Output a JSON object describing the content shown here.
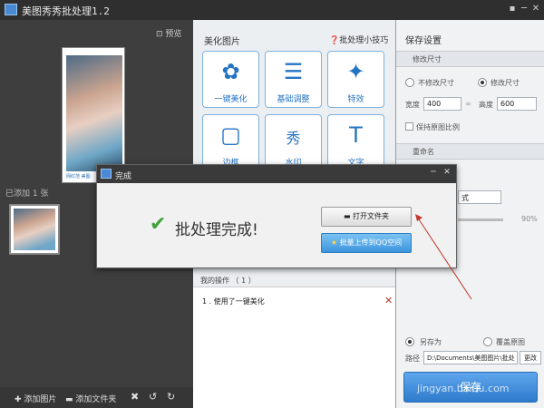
{
  "window": {
    "title": "美图秀秀批处理1.2",
    "controls": [
      "▪",
      "─",
      "✕"
    ]
  },
  "left_panel": {
    "preview_label": "预览",
    "phone_caption": "网红范 美图",
    "added_count_text": "已添加 1 张",
    "bottom_bar": {
      "add_image": "添加图片",
      "add_folder": "添加文件夹"
    }
  },
  "middle_panel": {
    "title": "美化图片",
    "tips_label": "批处理小技巧",
    "tools": [
      {
        "label": "一键美化",
        "icon": "tulip-icon"
      },
      {
        "label": "基础调整",
        "icon": "sliders-icon"
      },
      {
        "label": "特效",
        "icon": "magic-wand-icon"
      },
      {
        "label": "边框",
        "icon": "frame-icon"
      },
      {
        "label": "水印",
        "icon": "watermark-icon"
      },
      {
        "label": "文字",
        "icon": "text-icon"
      }
    ],
    "tool_glyphs": [
      "✿",
      "☰",
      "✦",
      "▢",
      "秀",
      "T"
    ],
    "ops_title": "我的操作 （ 1 ）",
    "ops_items": [
      "1 . 使用了一键美化"
    ],
    "ops_delete": "✕"
  },
  "right_panel": {
    "title": "保存设置",
    "resize_section": "修改尺寸",
    "no_resize_label": "不修改尺寸",
    "resize_label": "修改尺寸",
    "width_label": "宽度",
    "width_value": "400",
    "height_label": "高度",
    "height_value": "600",
    "keep_ratio_label": "保持原图比例",
    "rename_section": "重命名",
    "format_value": "式",
    "quality_value": "90%",
    "save_as_label": "另存为",
    "overwrite_label": "覆盖原图",
    "path_label": "路径",
    "path_value": "D:\\Documents\\美图图片\\批处",
    "change_button": "更改",
    "save_button": "保存"
  },
  "dialog": {
    "title": "完成",
    "message": "批处理完成!",
    "open_folder_button": "打开文件夹",
    "upload_button": "批量上传到QQ空间",
    "close": "✕",
    "minimize": "─"
  },
  "watermark": "jingyan.baidu.com"
}
